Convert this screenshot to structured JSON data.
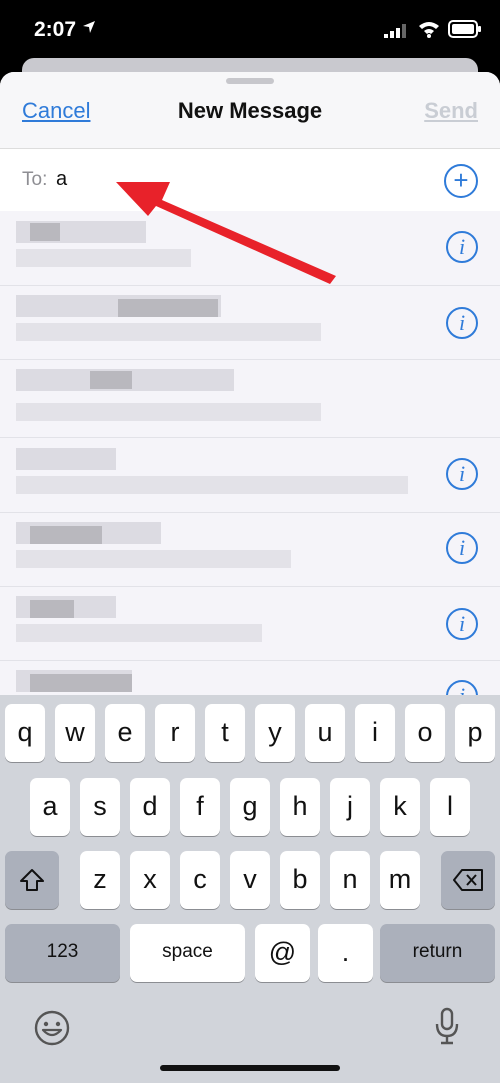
{
  "status_bar": {
    "time": "2:07"
  },
  "nav": {
    "cancel": "Cancel",
    "title": "New Message",
    "send": "Send"
  },
  "to_field": {
    "label": "To:",
    "value": "a"
  },
  "keyboard": {
    "row1": [
      "q",
      "w",
      "e",
      "r",
      "t",
      "y",
      "u",
      "i",
      "o",
      "p"
    ],
    "row2": [
      "a",
      "s",
      "d",
      "f",
      "g",
      "h",
      "j",
      "k",
      "l"
    ],
    "row3": [
      "z",
      "x",
      "c",
      "v",
      "b",
      "n",
      "m"
    ],
    "numbers": "123",
    "space": "space",
    "at": "@",
    "period": ".",
    "return": "return"
  },
  "icons": {
    "location": "location-arrow-icon",
    "signal": "cellular-signal-icon",
    "wifi": "wifi-icon",
    "battery": "battery-icon",
    "add_contact": "plus-circle-icon",
    "contact_info": "info-icon",
    "shift": "shift-icon",
    "delete": "backspace-icon",
    "emoji": "emoji-icon",
    "mic": "microphone-icon"
  },
  "colors": {
    "accent": "#2f7bd9",
    "arrow": "#e8222a"
  }
}
